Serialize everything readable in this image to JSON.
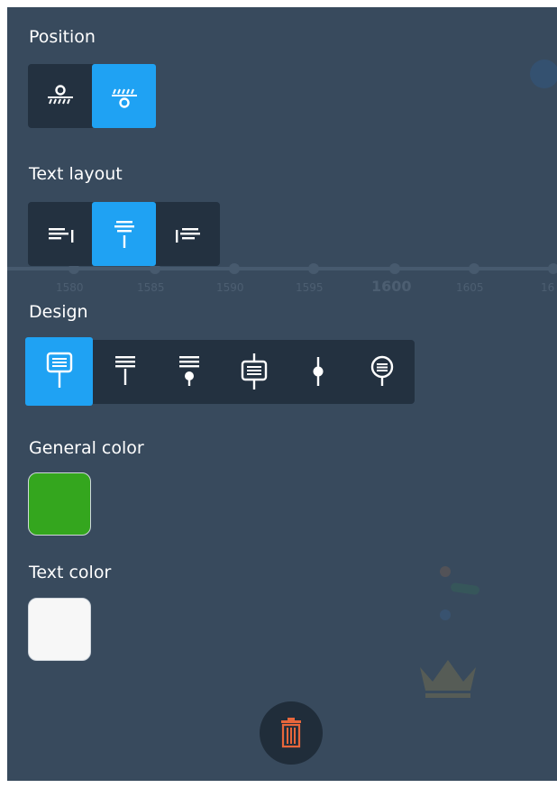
{
  "position": {
    "label": "Position",
    "options": [
      {
        "icon": "position-above-icon",
        "active": false
      },
      {
        "icon": "position-below-icon",
        "active": true
      }
    ]
  },
  "text_layout": {
    "label": "Text layout",
    "options": [
      {
        "icon": "text-left-icon",
        "active": false
      },
      {
        "icon": "text-center-icon",
        "active": true
      },
      {
        "icon": "text-right-icon",
        "active": false
      }
    ]
  },
  "design": {
    "label": "Design",
    "options": [
      {
        "icon": "design-box-pin-icon",
        "active": true
      },
      {
        "icon": "design-lines-pin-icon",
        "active": false
      },
      {
        "icon": "design-lines-dot-icon",
        "active": false
      },
      {
        "icon": "design-box-line-icon",
        "active": false
      },
      {
        "icon": "design-dot-line-icon",
        "active": false
      },
      {
        "icon": "design-circle-pin-icon",
        "active": false
      }
    ]
  },
  "general_color": {
    "label": "General color",
    "value": "#34a61e"
  },
  "text_color": {
    "label": "Text color",
    "value": "#f7f7f7"
  },
  "background_timeline": {
    "years": [
      "1580",
      "1585",
      "1590",
      "1595",
      "1600",
      "1605",
      "16"
    ]
  },
  "colors": {
    "panel_bg": "#384a5d",
    "group_bg": "#233140",
    "accent": "#1fa2f3",
    "delete_icon": "#e8663b"
  },
  "delete_icon": "trash-icon"
}
